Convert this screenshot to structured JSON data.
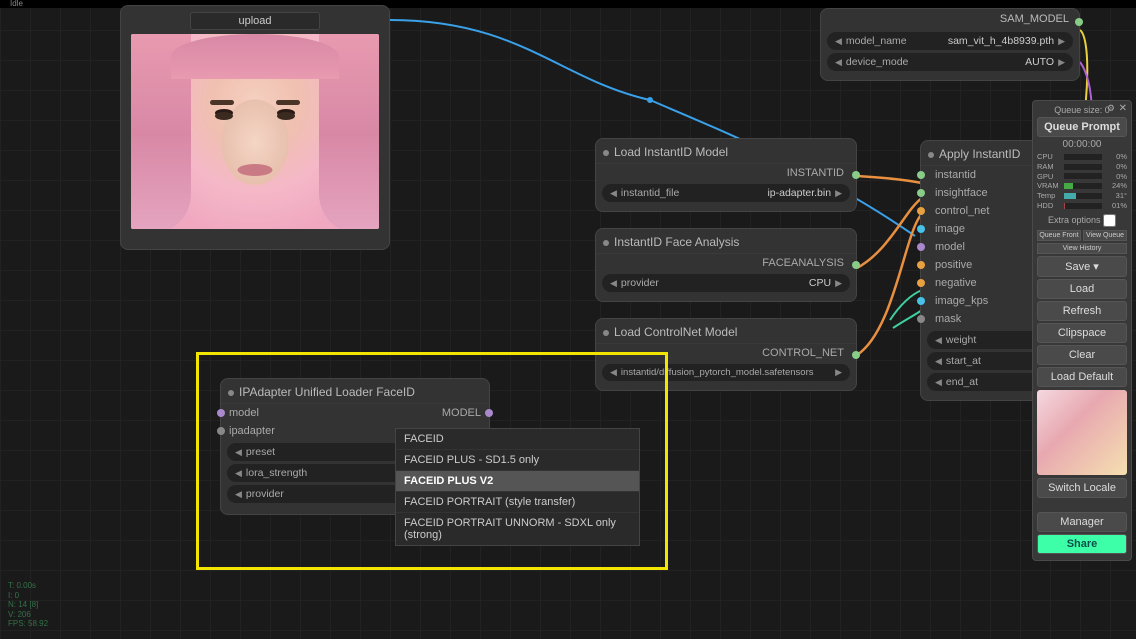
{
  "app_state": "Idle",
  "upload": {
    "button": "upload"
  },
  "sam": {
    "title": "SAM_MODEL",
    "model_name_label": "model_name",
    "model_name_value": "sam_vit_h_4b8939.pth",
    "device_label": "device_mode",
    "device_value": "AUTO"
  },
  "load_instantid": {
    "title": "Load InstantID Model",
    "output": "INSTANTID",
    "file_label": "instantid_file",
    "file_value": "ip-adapter.bin"
  },
  "face_analysis": {
    "title": "InstantID Face Analysis",
    "output": "FACEANALYSIS",
    "provider_label": "provider",
    "provider_value": "CPU"
  },
  "controlnet": {
    "title": "Load ControlNet Model",
    "output": "CONTROL_NET",
    "file_label": "instantid/diffusion_pytorch_model.safetensors"
  },
  "apply": {
    "title": "Apply InstantID",
    "inputs": [
      "instantid",
      "insightface",
      "control_net",
      "image",
      "model",
      "positive",
      "negative",
      "image_kps",
      "mask"
    ],
    "widgets": [
      "weight",
      "start_at",
      "end_at"
    ]
  },
  "ipadapter": {
    "title": "IPAdapter Unified Loader FaceID",
    "in0": "model",
    "in1": "ipadapter",
    "out0": "MODEL",
    "w_preset": "preset",
    "w_lora": "lora_strength",
    "w_provider": "provider"
  },
  "dropdown": {
    "options": [
      "FACEID",
      "FACEID PLUS - SD1.5 only",
      "FACEID PLUS V2",
      "FACEID PORTRAIT (style transfer)",
      "FACEID PORTRAIT UNNORM - SDXL only (strong)"
    ],
    "selected": 2
  },
  "panel": {
    "queue_size": "Queue size: 0",
    "queue_prompt": "Queue Prompt",
    "timer": "00:00:00",
    "stats": [
      {
        "k": "CPU",
        "v": "0%",
        "w": 0,
        "c": "#4a4"
      },
      {
        "k": "RAM",
        "v": "0%",
        "w": 0,
        "c": "#4a4"
      },
      {
        "k": "GPU",
        "v": "0%",
        "w": 0,
        "c": "#4a4"
      },
      {
        "k": "VRAM",
        "v": "24%",
        "w": 24,
        "c": "#4a4"
      },
      {
        "k": "Temp",
        "v": "31°",
        "w": 31,
        "c": "#4aa"
      },
      {
        "k": "HDD",
        "v": "01%",
        "w": 1,
        "c": "#a44"
      }
    ],
    "extra": "Extra options",
    "tiny": [
      "Queue Front",
      "View Queue",
      "View History"
    ],
    "buttons": [
      "Save  ▾",
      "Load",
      "Refresh",
      "Clipspace",
      "Clear",
      "Load Default"
    ],
    "switch_locale": "Switch Locale",
    "manager": "Manager",
    "share": "Share"
  },
  "bl": [
    "T: 0.00s",
    "I: 0",
    "N: 14 [8]",
    "V: 206",
    "FPS: 58.92"
  ]
}
